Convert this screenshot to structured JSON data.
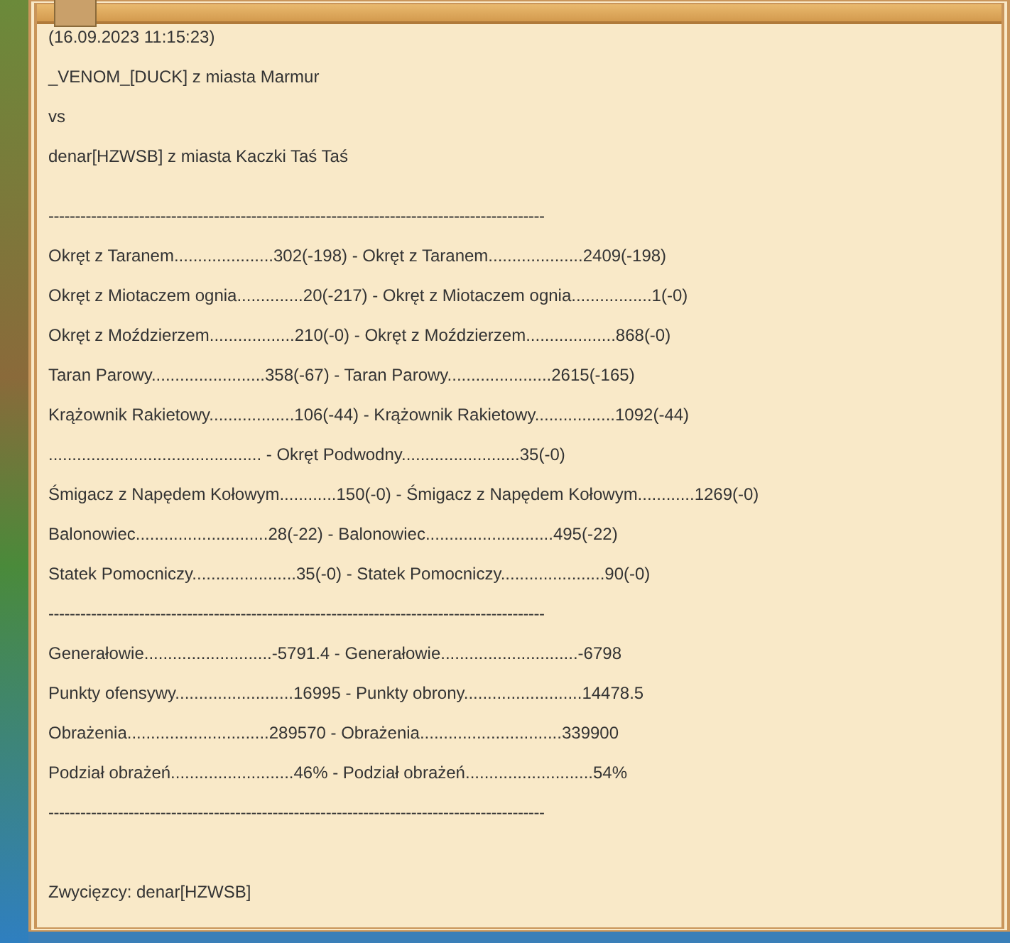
{
  "report": {
    "intro": [
      "(16.09.2023 11:15:23)",
      "_VENOM_[DUCK] z miasta Marmur",
      "vs",
      "denar[HZWSB] z miasta Kaczki Taś Taś"
    ],
    "sections": [
      {
        "rule": "---------------------------------------------------------------------------------------------",
        "rows": [
          "Okręt z Taranem.....................302(-198) - Okręt z Taranem....................2409(-198)",
          "Okręt z Miotaczem ognia..............20(-217) - Okręt z Miotaczem ognia.................1(-0)",
          "Okręt z Moździerzem..................210(-0) - Okręt z Moździerzem...................868(-0)",
          "Taran Parowy........................358(-67) - Taran Parowy......................2615(-165)",
          "Krążownik Rakietowy..................106(-44) - Krążownik Rakietowy.................1092(-44)",
          "............................................. - Okręt Podwodny.........................35(-0)",
          "Śmigacz z Napędem Kołowym............150(-0) - Śmigacz z Napędem Kołowym............1269(-0)",
          "Balonowiec............................28(-22) - Balonowiec...........................495(-22)",
          "Statek Pomocniczy......................35(-0) - Statek Pomocniczy......................90(-0)"
        ]
      },
      {
        "rule": "---------------------------------------------------------------------------------------------",
        "rows": [
          "Generałowie...........................-5791.4 - Generałowie.............................-6798",
          "Punkty ofensywy.........................16995 - Punkty obrony.........................14478.5",
          "Obrażenia..............................289570 - Obrażenia..............................339900",
          "Podział obrażeń..........................46% - Podział obrażeń...........................54%"
        ]
      }
    ],
    "closing_rule": "---------------------------------------------------------------------------------------------",
    "winner": "Zwycięzcy: denar[HZWSB]"
  }
}
